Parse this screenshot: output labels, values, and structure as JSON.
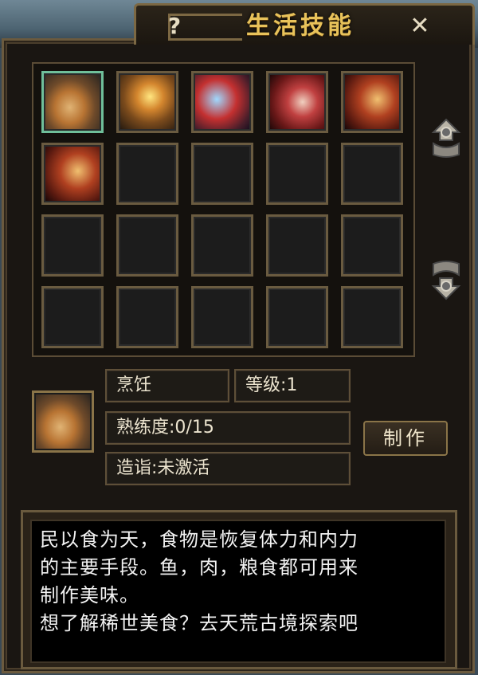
{
  "window": {
    "title": "生活技能",
    "help_label": "?",
    "close_label": "✕"
  },
  "grid": {
    "rows": 4,
    "cols": 5,
    "items": [
      {
        "icon": "roast-chicken-icon",
        "art": "food",
        "selected": true
      },
      {
        "icon": "forging-anvil-icon",
        "art": "forge",
        "selected": false
      },
      {
        "icon": "potion-brewing-icon",
        "art": "potion",
        "selected": false
      },
      {
        "icon": "tailoring-needle-icon",
        "art": "sew",
        "selected": false
      },
      {
        "icon": "crafting-hammer-icon",
        "art": "craft",
        "selected": false
      },
      {
        "icon": "crafting-hammer-icon",
        "art": "craft",
        "selected": false
      }
    ]
  },
  "scroll": {
    "up_icon": "scroll-up-arrow-icon",
    "down_icon": "scroll-down-arrow-icon"
  },
  "detail": {
    "icon": "roast-chicken-icon",
    "name": "烹饪",
    "level": "等级:1",
    "proficiency": "熟练度:0/15",
    "mastery": "造诣:未激活",
    "make_button": "制作"
  },
  "description": {
    "lines": [
      "民以食为天，食物是恢复体力和内力",
      "的主要手段。鱼，肉，粮食都可用来",
      "制作美味。",
      "想了解稀世美食？去天荒古境探索吧"
    ]
  },
  "colors": {
    "title": "#e8c25a",
    "frame": "#6b5a3e",
    "selected_border": "#6fbf9a"
  }
}
